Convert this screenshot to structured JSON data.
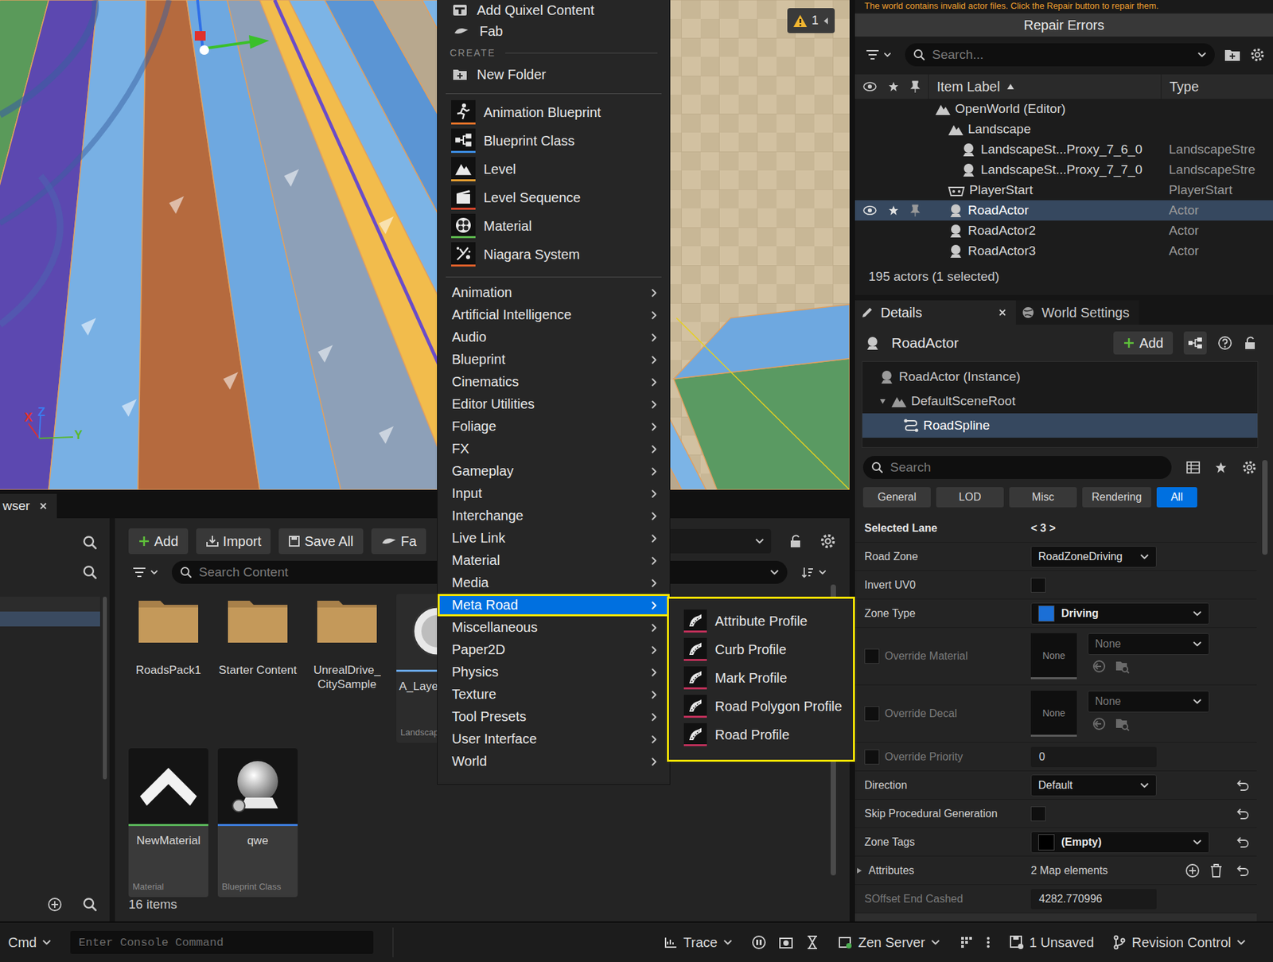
{
  "viewport": {
    "warning_count": "1",
    "axes": [
      {
        "label": "X",
        "color": "#e0322c"
      },
      {
        "label": "Z",
        "color": "#3b7cf0"
      },
      {
        "label": "Y",
        "color": "#58b82a"
      }
    ]
  },
  "context_menu": {
    "top_items": [
      {
        "label": "Add Quixel Content",
        "kind": "quixel"
      },
      {
        "label": "Fab",
        "kind": "fab"
      }
    ],
    "section_title": "CREATE",
    "new_folder": "New Folder",
    "create_items": [
      {
        "label": "Animation Blueprint",
        "kind": "animation",
        "color": "#e8742a"
      },
      {
        "label": "Blueprint Class",
        "kind": "blueprint",
        "color": "#3d8ee6"
      },
      {
        "label": "Level",
        "kind": "level",
        "color": "#e8a030"
      },
      {
        "label": "Level Sequence",
        "kind": "sequence",
        "color": "#d8452c"
      },
      {
        "label": "Material",
        "kind": "material",
        "color": "#5db84e"
      },
      {
        "label": "Niagara System",
        "kind": "niagara",
        "color": "#e0602a"
      }
    ],
    "categories": [
      {
        "label": "Animation",
        "selected": false
      },
      {
        "label": "Artificial Intelligence",
        "selected": false
      },
      {
        "label": "Audio",
        "selected": false
      },
      {
        "label": "Blueprint",
        "selected": false
      },
      {
        "label": "Cinematics",
        "selected": false
      },
      {
        "label": "Editor Utilities",
        "selected": false
      },
      {
        "label": "Foliage",
        "selected": false
      },
      {
        "label": "FX",
        "selected": false
      },
      {
        "label": "Gameplay",
        "selected": false
      },
      {
        "label": "Input",
        "selected": false
      },
      {
        "label": "Interchange",
        "selected": false
      },
      {
        "label": "Live Link",
        "selected": false
      },
      {
        "label": "Material",
        "selected": false
      },
      {
        "label": "Media",
        "selected": false
      },
      {
        "label": "Meta Road",
        "selected": true
      },
      {
        "label": "Miscellaneous",
        "selected": false
      },
      {
        "label": "Paper2D",
        "selected": false
      },
      {
        "label": "Physics",
        "selected": false
      },
      {
        "label": "Texture",
        "selected": false
      },
      {
        "label": "Tool Presets",
        "selected": false
      },
      {
        "label": "User Interface",
        "selected": false
      },
      {
        "label": "World",
        "selected": false
      }
    ]
  },
  "submenu": {
    "items": [
      "Attribute Profile",
      "Curb Profile",
      "Mark Profile",
      "Road Polygon Profile",
      "Road Profile"
    ]
  },
  "outliner": {
    "banner": "The world contains invalid actor files. Click the Repair button to repair them.",
    "repair_button": "Repair Errors",
    "search_placeholder": "Search...",
    "columns": [
      "Item Label",
      "Type"
    ],
    "rows": [
      {
        "label": "OpenWorld (Editor)",
        "type": "",
        "depth": 0,
        "kind": "world",
        "selected": false
      },
      {
        "label": "Landscape",
        "type": "",
        "depth": 1,
        "kind": "landscape",
        "selected": false
      },
      {
        "label": "LandscapeSt...Proxy_7_6_0",
        "type": "LandscapeStre",
        "depth": 2,
        "kind": "actor",
        "selected": false
      },
      {
        "label": "LandscapeSt...Proxy_7_7_0",
        "type": "LandscapeStre",
        "depth": 2,
        "kind": "actor",
        "selected": false
      },
      {
        "label": "PlayerStart",
        "type": "PlayerStart",
        "depth": 1,
        "kind": "playerstart",
        "selected": false
      },
      {
        "label": "RoadActor",
        "type": "Actor",
        "depth": 1,
        "kind": "actor",
        "selected": true
      },
      {
        "label": "RoadActor2",
        "type": "Actor",
        "depth": 1,
        "kind": "actor",
        "selected": false
      },
      {
        "label": "RoadActor3",
        "type": "Actor",
        "depth": 1,
        "kind": "actor",
        "selected": false
      }
    ],
    "count": "195 actors (1 selected)"
  },
  "details": {
    "tabs": [
      {
        "label": "Details",
        "selected": true,
        "kind": "details"
      },
      {
        "label": "World Settings",
        "selected": false,
        "kind": "world"
      }
    ],
    "actor_name": "RoadActor",
    "add_button": "Add",
    "components": [
      {
        "label": "RoadActor (Instance)",
        "depth": 0,
        "kind": "instance",
        "expandable": false,
        "expanded": false,
        "selected": false
      },
      {
        "label": "DefaultSceneRoot",
        "depth": 1,
        "kind": "root",
        "expandable": true,
        "expanded": true,
        "selected": false
      },
      {
        "label": "RoadSpline",
        "depth": 2,
        "kind": "spline",
        "expandable": false,
        "expanded": false,
        "selected": true
      }
    ],
    "search_placeholder": "Search",
    "filters": [
      {
        "label": "General",
        "selected": false
      },
      {
        "label": "LOD",
        "selected": false
      },
      {
        "label": "Misc",
        "selected": false
      },
      {
        "label": "Rendering",
        "selected": false
      },
      {
        "label": "All",
        "selected": true
      }
    ],
    "properties": [
      {
        "kind": "readonly",
        "label": "Selected Lane",
        "value": "< 3 >",
        "emphasis": true,
        "reset": false
      },
      {
        "kind": "dropdown",
        "label": "Road Zone",
        "value": "RoadZoneDriving",
        "emphasis": false,
        "reset": false
      },
      {
        "kind": "checkbox",
        "label": "Invert UV0",
        "checked": false,
        "emphasis": false,
        "reset": false
      },
      {
        "kind": "swatch",
        "label": "Zone Type",
        "value": "Driving",
        "color": "#1b6fd6",
        "emphasis": false,
        "reset": false
      },
      {
        "kind": "asset",
        "label": "Override Material",
        "thumbnail": "None",
        "value": "None",
        "checked": false,
        "disabled": true,
        "emphasis": false,
        "reset": false
      },
      {
        "kind": "asset",
        "label": "Override Decal",
        "thumbnail": "None",
        "value": "None",
        "checked": false,
        "disabled": true,
        "emphasis": false,
        "reset": false
      },
      {
        "kind": "toggled-number",
        "label": "Override Priority",
        "value": "0",
        "checked": false,
        "disabled": true,
        "emphasis": false,
        "reset": false
      },
      {
        "kind": "dropdown",
        "label": "Direction",
        "value": "Default",
        "emphasis": false,
        "reset": true
      },
      {
        "kind": "checkbox",
        "label": "Skip Procedural Generation",
        "checked": false,
        "emphasis": false,
        "reset": true
      },
      {
        "kind": "swatch",
        "label": "Zone Tags",
        "value": "(Empty)",
        "color": "#000000",
        "emphasis": false,
        "reset": true
      },
      {
        "kind": "map",
        "label": "Attributes",
        "value": "2 Map elements",
        "expanded": false,
        "emphasis": false,
        "reset": true
      },
      {
        "kind": "number",
        "label": "SOffset End Cashed",
        "value": "4282.770996",
        "disabled": true,
        "emphasis": false,
        "reset": false
      }
    ]
  },
  "content_browser": {
    "tab": "wser",
    "toolbar": [
      {
        "label": "Add",
        "kind": "add"
      },
      {
        "label": "Import",
        "kind": "import"
      },
      {
        "label": "Save All",
        "kind": "save"
      },
      {
        "label": "Fa",
        "kind": "fab"
      }
    ],
    "search_placeholder": "Search Content",
    "rows": [
      [
        {
          "kind": "folder",
          "name": "RoadsPack1",
          "type": "",
          "color": ""
        },
        {
          "kind": "folder",
          "name": "Starter Content",
          "type": "",
          "color": ""
        },
        {
          "kind": "folder",
          "name": "UnrealDrive_CitySample",
          "type": "",
          "color": ""
        },
        {
          "kind": "layer",
          "name": "A_Laye",
          "type": "Landscap",
          "color": "#6aa8e8"
        }
      ],
      [
        {
          "kind": "material",
          "name": "NewMaterial",
          "type": "Material",
          "color": "#5cb85c"
        },
        {
          "kind": "blueprint",
          "name": "qwe",
          "type": "Blueprint Class",
          "color": "#3f7fe0"
        }
      ]
    ],
    "count": "16 items"
  },
  "status_bar": {
    "cmd": "Cmd",
    "console_placeholder": "Enter Console Command",
    "trace": "Trace",
    "zen": "Zen Server",
    "unsaved": "1 Unsaved",
    "revision": "Revision Control"
  }
}
